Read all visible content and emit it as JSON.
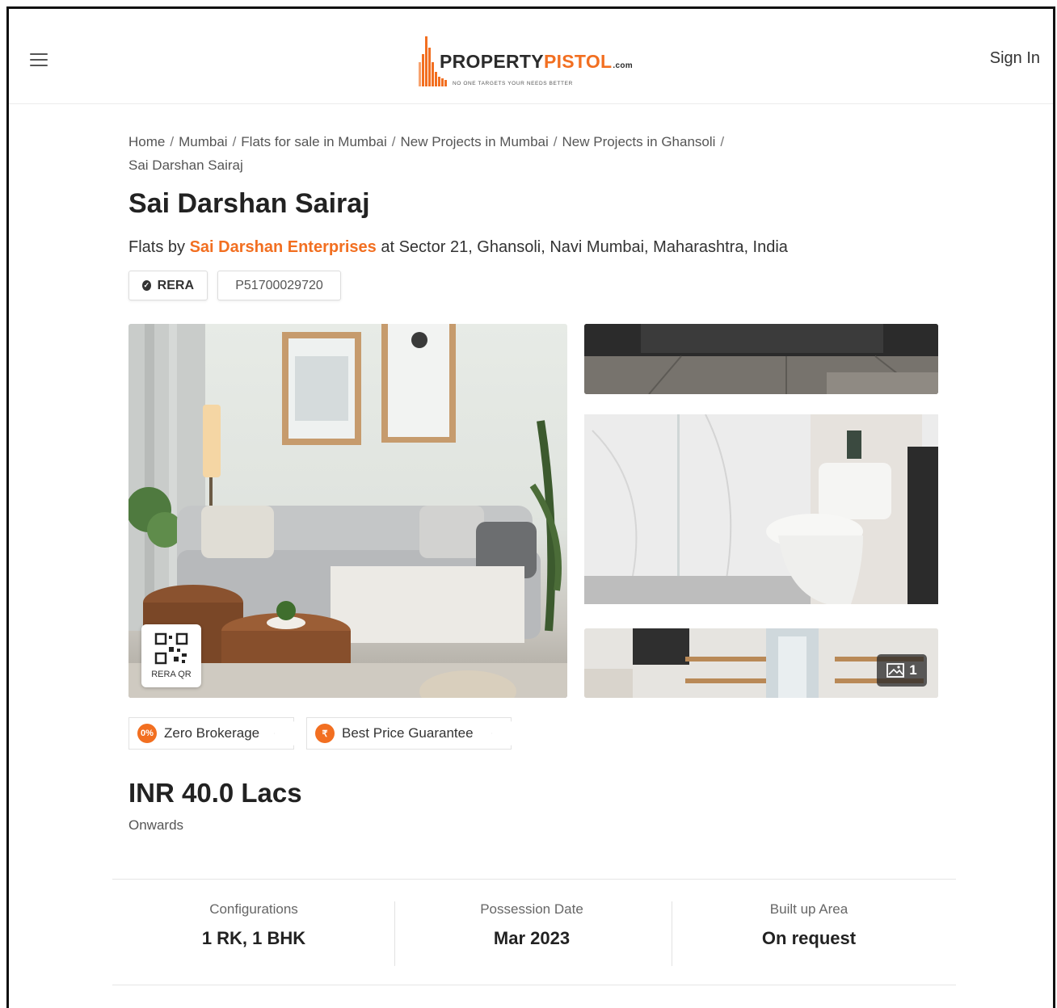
{
  "header": {
    "logo_name_dark": "PROPERTY",
    "logo_name_orange": "PISTOL",
    "logo_suffix": ".com",
    "logo_tagline": "NO ONE TARGETS YOUR NEEDS BETTER",
    "sign_in": "Sign In"
  },
  "breadcrumb": [
    "Home",
    "Mumbai",
    "Flats for sale in Mumbai",
    "New Projects in Mumbai",
    "New Projects in Ghansoli",
    "Sai Darshan Sairaj"
  ],
  "project": {
    "title": "Sai Darshan Sairaj",
    "subtitle_prefix": "Flats by ",
    "developer": "Sai Darshan Enterprises",
    "subtitle_suffix": " at Sector 21, Ghansoli, Navi Mumbai, Maharashtra, India",
    "rera_label": "RERA",
    "rera_number": "P51700029720"
  },
  "gallery": {
    "rera_qr_label": "RERA QR",
    "photo_count": "1"
  },
  "tags": {
    "zero_brokerage_icon": "0%",
    "zero_brokerage": "Zero Brokerage",
    "best_price_icon": "₹",
    "best_price": "Best Price Guarantee"
  },
  "price": {
    "amount": "INR 40.0 Lacs",
    "note": "Onwards"
  },
  "stats": [
    {
      "label": "Configurations",
      "value": "1 RK, 1 BHK"
    },
    {
      "label": "Possession Date",
      "value": "Mar 2023"
    },
    {
      "label": "Built up Area",
      "value": "On request"
    }
  ],
  "colors": {
    "brand_orange": "#f26f21",
    "text_dark": "#222222"
  }
}
